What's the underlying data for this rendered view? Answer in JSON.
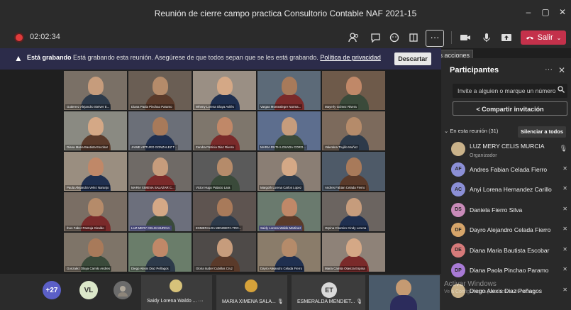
{
  "window": {
    "title": "Reunión de cierre campo practica Consultorio Contable NAF 2021-15",
    "min": "–",
    "max": "▢",
    "close": "✕"
  },
  "toolbar": {
    "timer": "02:02:34",
    "more_tooltip": "Más acciones",
    "more_label": "···",
    "leave_label": "Salir"
  },
  "banner": {
    "bold": "Está grabando",
    "text": "Está grabando esta reunión. Asegúrese de que todos sepan que se les está grabando.",
    "link": "Política de privacidad",
    "dismiss": "Descartar"
  },
  "grid": [
    [
      "Gutierrez Alejandro Steiver E...",
      "Diana Paola Pinchao Paramo",
      "Wheny Lorena Olaya Avilés",
      "Vargas Montealegre Norma...",
      "Mayerly Gómez Rivera"
    ],
    [
      "Diana Maria Bautista Escobar",
      "JAIME ARTURO GONZALEZ T...",
      "Zandra Patricia Diaz Rivera",
      "MARIA RUTH LOSADA CORO...",
      "Valentina Trujillo Muñoz"
    ],
    [
      "Paula Alejandra Velez Naranjo",
      "MARIA XIMENA SALAZAR C...",
      "Victor Hugo Palacio Lara",
      "Margoth Lorena Carlos Lopez",
      "Andres Fabian Celada Fierro"
    ],
    [
      "Ibon Faber Pantoja Giraldo",
      "LUZ MERY CELIS MURCIA",
      "ESMERALDA MENDIETA TRO...",
      "Saidy Lorena Waldo Martinez",
      "Orpina Chamiro Cindy Lorena"
    ],
    [
      "Gonzalez Olaya Camilo Andres",
      "Diego Alexis Diaz Peñagos",
      "Gloria Isabel Cubillos Cruz",
      "Dayro Alejandro Celada Fierro",
      "Maria Camila Otaviza Espina"
    ]
  ],
  "strip": {
    "count": "+27",
    "vl": "VL",
    "et": "ET",
    "tile1": "Saidy Lorena Waldo ...",
    "tile1_more": "···",
    "tile2": "MARIA XIMENA SALA...",
    "tile3": "ESMERALDA MENDIET..."
  },
  "panel": {
    "title": "Participantes",
    "invite_placeholder": "Invite a alguien o marque un número",
    "share": "Compartir invitación",
    "section": "En esta reunión (31)",
    "mute_all": "Silenciar a todos",
    "participants": [
      {
        "initials": "",
        "name": "LUZ MERY CELIS MURCIA",
        "role": "Organizador"
      },
      {
        "initials": "AF",
        "name": "Andres Fabian Celada Fierro"
      },
      {
        "initials": "AC",
        "name": "Anyi Lorena Hernandez Carillo"
      },
      {
        "initials": "DS",
        "name": "Daniela Fierro Silva"
      },
      {
        "initials": "DF",
        "name": "Dayro Alejandro Celada Fierro"
      },
      {
        "initials": "DE",
        "name": "Diana Maria Bautista Escobar"
      },
      {
        "initials": "DP",
        "name": "Diana Paola Pinchao Paramo"
      },
      {
        "initials": "",
        "name": "Diego Alexis Diaz Peñagos"
      }
    ]
  },
  "watermark": {
    "line1": "Activar Windows",
    "line2": "Ve a Configuración para activar Windows."
  },
  "colors": {
    "accent": "#464775",
    "leave": "#c4314b",
    "panel": "#292929",
    "banner": "#2c2c4a"
  }
}
